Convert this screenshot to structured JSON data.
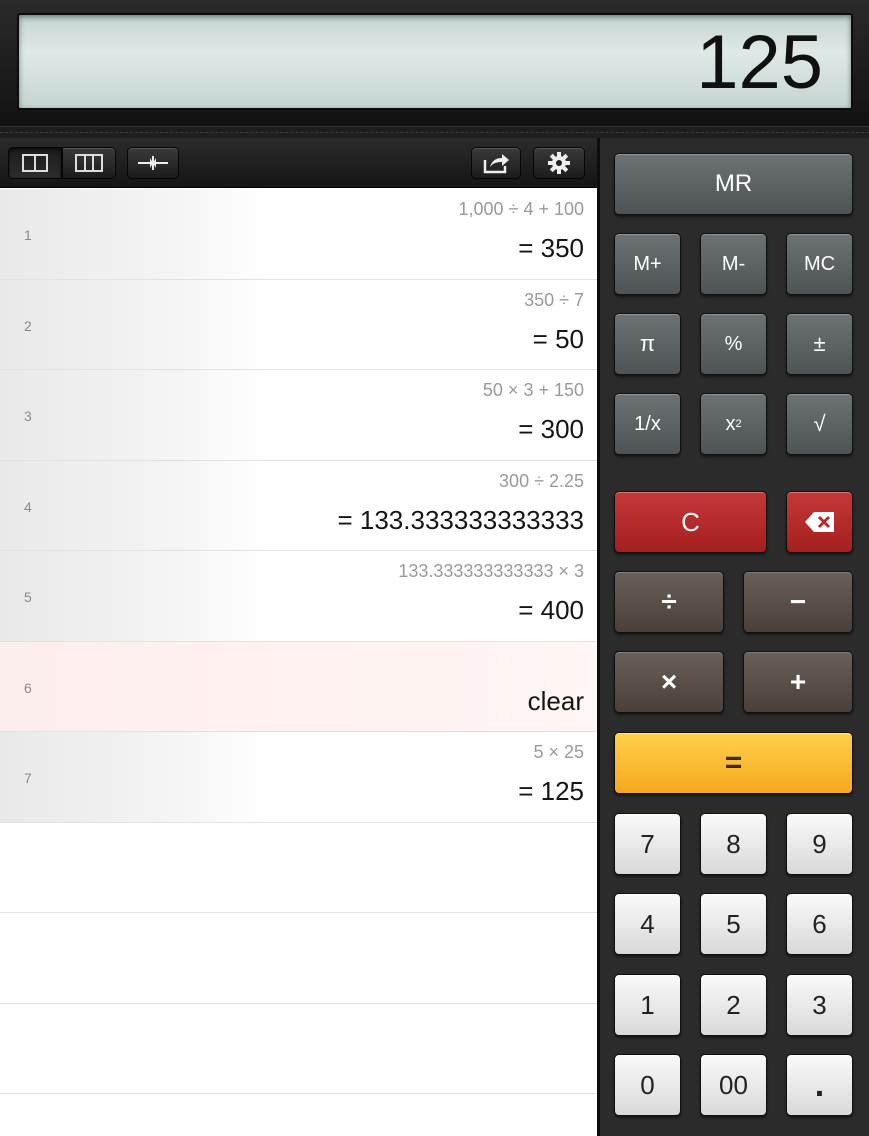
{
  "display": {
    "value": "125"
  },
  "toolbar": {
    "layout_single_icon": "two-column-layout-icon",
    "layout_triple_icon": "three-column-layout-icon",
    "collapse_icon": "collapse-arrows-icon",
    "share_icon": "share-icon",
    "settings_icon": "gear-icon"
  },
  "history": [
    {
      "index": "1",
      "expr": "1,000 ÷ 4 + 100",
      "result": "= 350"
    },
    {
      "index": "2",
      "expr": "350 ÷ 7",
      "result": "= 50"
    },
    {
      "index": "3",
      "expr": "50 × 3 + 150",
      "result": "= 300"
    },
    {
      "index": "4",
      "expr": "300 ÷ 2.25",
      "result": "= 133.333333333333"
    },
    {
      "index": "5",
      "expr": "133.333333333333 × 3",
      "result": "= 400"
    },
    {
      "index": "6",
      "expr": "",
      "result": "clear"
    },
    {
      "index": "7",
      "expr": "5 × 25",
      "result": "= 125"
    }
  ],
  "keys": {
    "mr": "MR",
    "mplus": "M+",
    "mminus": "M-",
    "mc": "MC",
    "pi": "π",
    "percent": "%",
    "plusminus": "±",
    "reciprocal": "1/x",
    "square_base": "x",
    "square_exp": "2",
    "sqrt": "√",
    "clear": "C",
    "divide": "÷",
    "subtract": "−",
    "multiply": "×",
    "add": "+",
    "equals": "=",
    "d7": "7",
    "d8": "8",
    "d9": "9",
    "d4": "4",
    "d5": "5",
    "d6": "6",
    "d1": "1",
    "d2": "2",
    "d3": "3",
    "d0": "0",
    "d00": "00",
    "decimal": "."
  },
  "colors": {
    "clear_key": "#b52a2a",
    "equals_key": "#f8b52c",
    "operator_key": "#5a4e49"
  }
}
